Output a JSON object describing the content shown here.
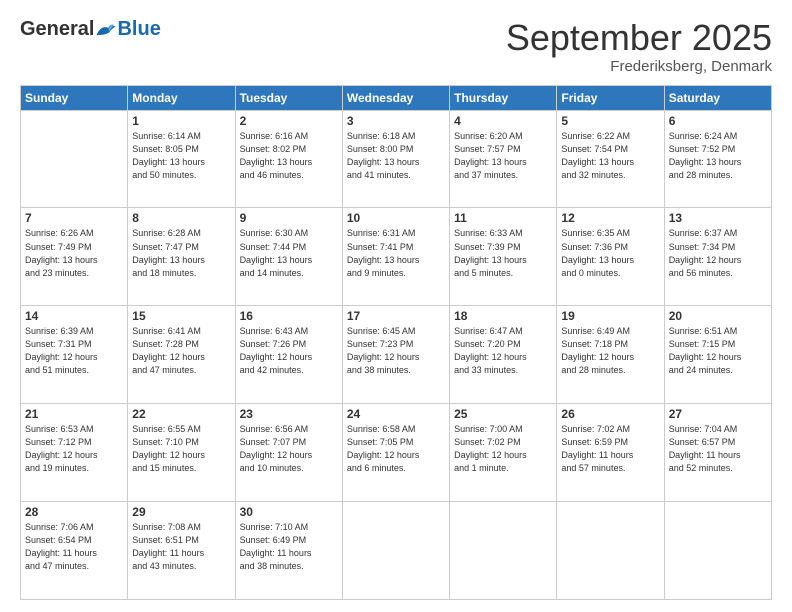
{
  "header": {
    "logo_general": "General",
    "logo_blue": "Blue",
    "month_title": "September 2025",
    "location": "Frederiksberg, Denmark"
  },
  "weekdays": [
    "Sunday",
    "Monday",
    "Tuesday",
    "Wednesday",
    "Thursday",
    "Friday",
    "Saturday"
  ],
  "weeks": [
    [
      {
        "day": "",
        "info": ""
      },
      {
        "day": "1",
        "info": "Sunrise: 6:14 AM\nSunset: 8:05 PM\nDaylight: 13 hours\nand 50 minutes."
      },
      {
        "day": "2",
        "info": "Sunrise: 6:16 AM\nSunset: 8:02 PM\nDaylight: 13 hours\nand 46 minutes."
      },
      {
        "day": "3",
        "info": "Sunrise: 6:18 AM\nSunset: 8:00 PM\nDaylight: 13 hours\nand 41 minutes."
      },
      {
        "day": "4",
        "info": "Sunrise: 6:20 AM\nSunset: 7:57 PM\nDaylight: 13 hours\nand 37 minutes."
      },
      {
        "day": "5",
        "info": "Sunrise: 6:22 AM\nSunset: 7:54 PM\nDaylight: 13 hours\nand 32 minutes."
      },
      {
        "day": "6",
        "info": "Sunrise: 6:24 AM\nSunset: 7:52 PM\nDaylight: 13 hours\nand 28 minutes."
      }
    ],
    [
      {
        "day": "7",
        "info": "Sunrise: 6:26 AM\nSunset: 7:49 PM\nDaylight: 13 hours\nand 23 minutes."
      },
      {
        "day": "8",
        "info": "Sunrise: 6:28 AM\nSunset: 7:47 PM\nDaylight: 13 hours\nand 18 minutes."
      },
      {
        "day": "9",
        "info": "Sunrise: 6:30 AM\nSunset: 7:44 PM\nDaylight: 13 hours\nand 14 minutes."
      },
      {
        "day": "10",
        "info": "Sunrise: 6:31 AM\nSunset: 7:41 PM\nDaylight: 13 hours\nand 9 minutes."
      },
      {
        "day": "11",
        "info": "Sunrise: 6:33 AM\nSunset: 7:39 PM\nDaylight: 13 hours\nand 5 minutes."
      },
      {
        "day": "12",
        "info": "Sunrise: 6:35 AM\nSunset: 7:36 PM\nDaylight: 13 hours\nand 0 minutes."
      },
      {
        "day": "13",
        "info": "Sunrise: 6:37 AM\nSunset: 7:34 PM\nDaylight: 12 hours\nand 56 minutes."
      }
    ],
    [
      {
        "day": "14",
        "info": "Sunrise: 6:39 AM\nSunset: 7:31 PM\nDaylight: 12 hours\nand 51 minutes."
      },
      {
        "day": "15",
        "info": "Sunrise: 6:41 AM\nSunset: 7:28 PM\nDaylight: 12 hours\nand 47 minutes."
      },
      {
        "day": "16",
        "info": "Sunrise: 6:43 AM\nSunset: 7:26 PM\nDaylight: 12 hours\nand 42 minutes."
      },
      {
        "day": "17",
        "info": "Sunrise: 6:45 AM\nSunset: 7:23 PM\nDaylight: 12 hours\nand 38 minutes."
      },
      {
        "day": "18",
        "info": "Sunrise: 6:47 AM\nSunset: 7:20 PM\nDaylight: 12 hours\nand 33 minutes."
      },
      {
        "day": "19",
        "info": "Sunrise: 6:49 AM\nSunset: 7:18 PM\nDaylight: 12 hours\nand 28 minutes."
      },
      {
        "day": "20",
        "info": "Sunrise: 6:51 AM\nSunset: 7:15 PM\nDaylight: 12 hours\nand 24 minutes."
      }
    ],
    [
      {
        "day": "21",
        "info": "Sunrise: 6:53 AM\nSunset: 7:12 PM\nDaylight: 12 hours\nand 19 minutes."
      },
      {
        "day": "22",
        "info": "Sunrise: 6:55 AM\nSunset: 7:10 PM\nDaylight: 12 hours\nand 15 minutes."
      },
      {
        "day": "23",
        "info": "Sunrise: 6:56 AM\nSunset: 7:07 PM\nDaylight: 12 hours\nand 10 minutes."
      },
      {
        "day": "24",
        "info": "Sunrise: 6:58 AM\nSunset: 7:05 PM\nDaylight: 12 hours\nand 6 minutes."
      },
      {
        "day": "25",
        "info": "Sunrise: 7:00 AM\nSunset: 7:02 PM\nDaylight: 12 hours\nand 1 minute."
      },
      {
        "day": "26",
        "info": "Sunrise: 7:02 AM\nSunset: 6:59 PM\nDaylight: 11 hours\nand 57 minutes."
      },
      {
        "day": "27",
        "info": "Sunrise: 7:04 AM\nSunset: 6:57 PM\nDaylight: 11 hours\nand 52 minutes."
      }
    ],
    [
      {
        "day": "28",
        "info": "Sunrise: 7:06 AM\nSunset: 6:54 PM\nDaylight: 11 hours\nand 47 minutes."
      },
      {
        "day": "29",
        "info": "Sunrise: 7:08 AM\nSunset: 6:51 PM\nDaylight: 11 hours\nand 43 minutes."
      },
      {
        "day": "30",
        "info": "Sunrise: 7:10 AM\nSunset: 6:49 PM\nDaylight: 11 hours\nand 38 minutes."
      },
      {
        "day": "",
        "info": ""
      },
      {
        "day": "",
        "info": ""
      },
      {
        "day": "",
        "info": ""
      },
      {
        "day": "",
        "info": ""
      }
    ]
  ]
}
